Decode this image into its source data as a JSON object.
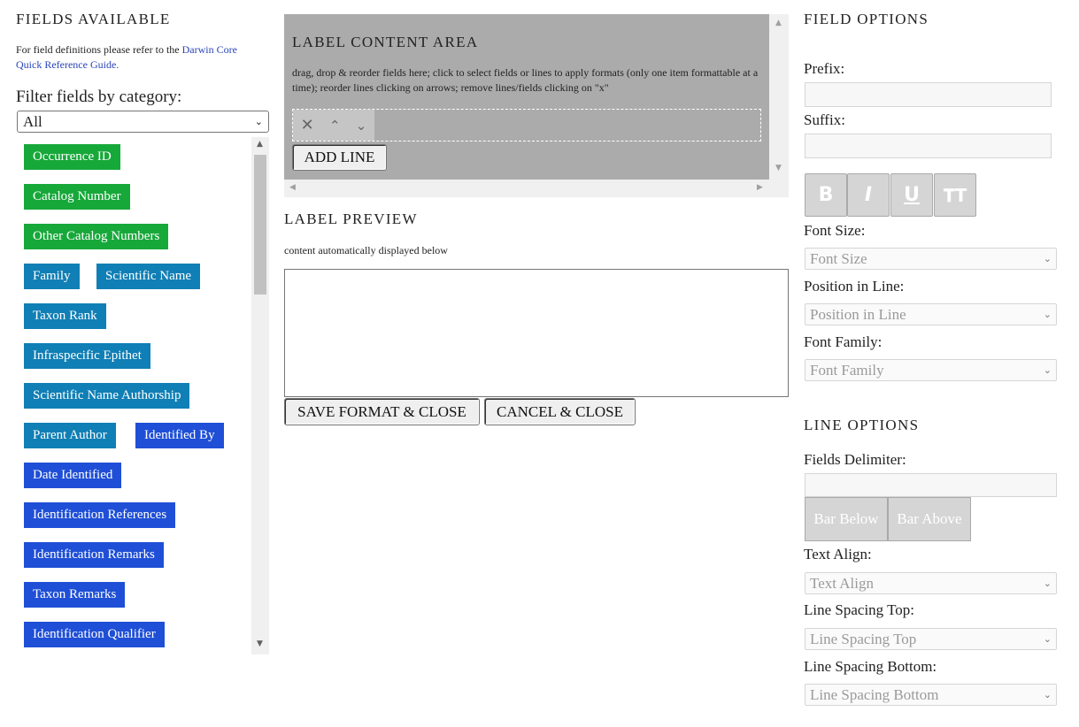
{
  "fields_available": {
    "title": "FIELDS AVAILABLE",
    "intro_text": "For field definitions please refer to the",
    "link_text_1": "Darwin Core",
    "link_text_2": "Quick Reference Guide.",
    "filter_label": "Filter fields by category:",
    "filter_value": "All",
    "fields": [
      {
        "label": "Occurrence ID",
        "color": "#17a83a"
      },
      {
        "label": "Catalog Number",
        "color": "#17a83a"
      },
      {
        "label": "Other Catalog Numbers",
        "color": "#17a83a"
      },
      {
        "label": "Family",
        "color": "#107fb5"
      },
      {
        "label": "Scientific Name",
        "color": "#107fb5"
      },
      {
        "label": "Taxon Rank",
        "color": "#107fb5"
      },
      {
        "label": "Infraspecific Epithet",
        "color": "#107fb5"
      },
      {
        "label": "Scientific Name Authorship",
        "color": "#107fb5"
      },
      {
        "label": "Parent Author",
        "color": "#107fb5"
      },
      {
        "label": "Identified By",
        "color": "#1f4fd6"
      },
      {
        "label": "Date Identified",
        "color": "#1f4fd6"
      },
      {
        "label": "Identification References",
        "color": "#1f4fd6"
      },
      {
        "label": "Identification Remarks",
        "color": "#1f4fd6"
      },
      {
        "label": "Taxon Remarks",
        "color": "#1f4fd6"
      },
      {
        "label": "Identification Qualifier",
        "color": "#1f4fd6"
      }
    ]
  },
  "label_content": {
    "title": "LABEL CONTENT AREA",
    "instructions": "drag, drop & reorder fields here; click to select fields or lines to apply formats (only one item formattable at a time); reorder lines clicking on arrows; remove lines/fields clicking on \"x\"",
    "add_line_label": "ADD LINE"
  },
  "label_preview": {
    "title": "LABEL PREVIEW",
    "subtitle": "content automatically displayed below",
    "save_label": "SAVE FORMAT & CLOSE",
    "cancel_label": "CANCEL & CLOSE"
  },
  "field_options": {
    "title": "FIELD OPTIONS",
    "prefix_label": "Prefix:",
    "suffix_label": "Suffix:",
    "font_size_label": "Font Size:",
    "font_size_placeholder": "Font Size",
    "position_label": "Position in Line:",
    "position_placeholder": "Position in Line",
    "font_family_label": "Font Family:",
    "font_family_placeholder": "Font Family"
  },
  "line_options": {
    "title": "LINE OPTIONS",
    "delimiter_label": "Fields Delimiter:",
    "bar_below_label": "Bar Below",
    "bar_above_label": "Bar Above",
    "text_align_label": "Text Align:",
    "text_align_placeholder": "Text Align",
    "spacing_top_label": "Line Spacing Top:",
    "spacing_top_placeholder": "Line Spacing Top",
    "spacing_bottom_label": "Line Spacing Bottom:",
    "spacing_bottom_placeholder": "Line Spacing Bottom"
  }
}
